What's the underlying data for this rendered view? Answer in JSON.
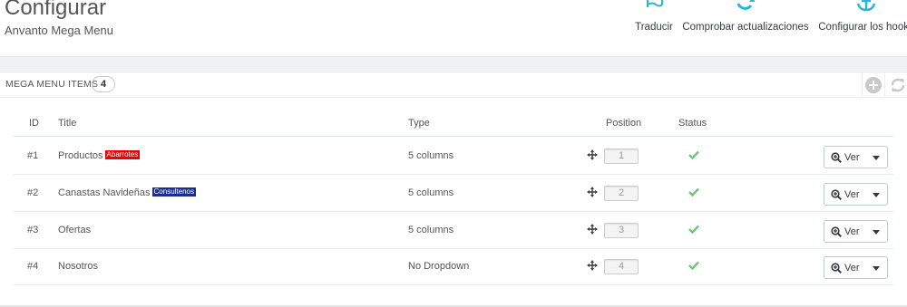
{
  "header": {
    "title": "Configurar",
    "subtitle": "Anvanto Mega Menu"
  },
  "toolbar": {
    "traducir_label": "Traducir",
    "comprobar_label": "Comprobar actualizaciones",
    "hooks_label": "Configurar los hooks"
  },
  "panel": {
    "title": "MEGA MENU ITEMS",
    "count": "4"
  },
  "table": {
    "headers": {
      "id": "ID",
      "title": "Title",
      "type": "Type",
      "position": "Position",
      "status": "Status"
    },
    "rows": [
      {
        "id": "#1",
        "title": "Productos",
        "tag": "Abarrotes",
        "tag_color": "#ee0000",
        "type": "5 columns",
        "position": "1",
        "status": "enabled",
        "action": "Ver"
      },
      {
        "id": "#2",
        "title": "Canastas Navideñas",
        "tag": "Consultenos",
        "tag_color": "#1b2e8f",
        "type": "5 columns",
        "position": "2",
        "status": "enabled",
        "action": "Ver"
      },
      {
        "id": "#3",
        "title": "Ofertas",
        "tag": "",
        "type": "5 columns",
        "position": "3",
        "status": "enabled",
        "action": "Ver"
      },
      {
        "id": "#4",
        "title": "Nosotros",
        "tag": "",
        "type": "No Dropdown",
        "position": "4",
        "status": "enabled",
        "action": "Ver"
      }
    ]
  },
  "colors": {
    "accent": "#25b9d7",
    "status_ok": "#72c279"
  },
  "icons": {
    "traducir": "flag-icon",
    "comprobar": "refresh-icon",
    "hooks": "anchor-icon",
    "add": "plus-circle-icon",
    "refresh": "refresh-icon",
    "drag": "move-icon",
    "status": "check-icon",
    "ver": "zoom-in-icon"
  }
}
